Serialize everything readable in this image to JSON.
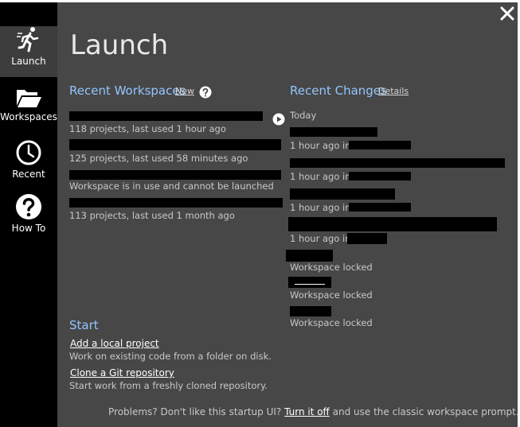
{
  "sidebar": {
    "items": [
      {
        "label": "Launch",
        "icon": "run-icon"
      },
      {
        "label": "Workspaces",
        "icon": "folder-icon"
      },
      {
        "label": "Recent",
        "icon": "clock-icon"
      },
      {
        "label": "How To",
        "icon": "help-icon"
      }
    ]
  },
  "header": {
    "title": "Launch"
  },
  "recent_workspaces": {
    "heading": "Recent Workspaces",
    "new_link": "New",
    "items": [
      {
        "detail": "118 projects, last used 1 hour ago"
      },
      {
        "detail": "125 projects, last used 58 minutes ago"
      },
      {
        "detail": "Workspace is in use and cannot be launched"
      },
      {
        "detail": "113 projects, last used 1 month ago"
      }
    ]
  },
  "recent_changes": {
    "heading": "Recent Changes",
    "details_link": "Details",
    "group_label": "Today",
    "items": [
      {
        "detail": "1 hour ago in"
      },
      {
        "detail": "1 hour ago in"
      },
      {
        "detail": "1 hour ago in"
      },
      {
        "detail": "1 hour ago in"
      },
      {
        "detail": "Workspace locked"
      },
      {
        "detail": "Workspace locked"
      },
      {
        "detail": "Workspace locked"
      }
    ]
  },
  "start": {
    "heading": "Start",
    "actions": [
      {
        "label": "Add a local project",
        "description": "Work on existing code from a folder on disk."
      },
      {
        "label": "Clone a Git repository",
        "description": "Start work from a freshly cloned repository."
      }
    ]
  },
  "footer": {
    "prefix": "Problems? Don't like this startup UI?",
    "link": "Turn it off",
    "suffix": "and use the classic workspace prompt."
  },
  "colors": {
    "accent": "#93c5ff",
    "background": "#474747",
    "sidebar": "#000000"
  }
}
